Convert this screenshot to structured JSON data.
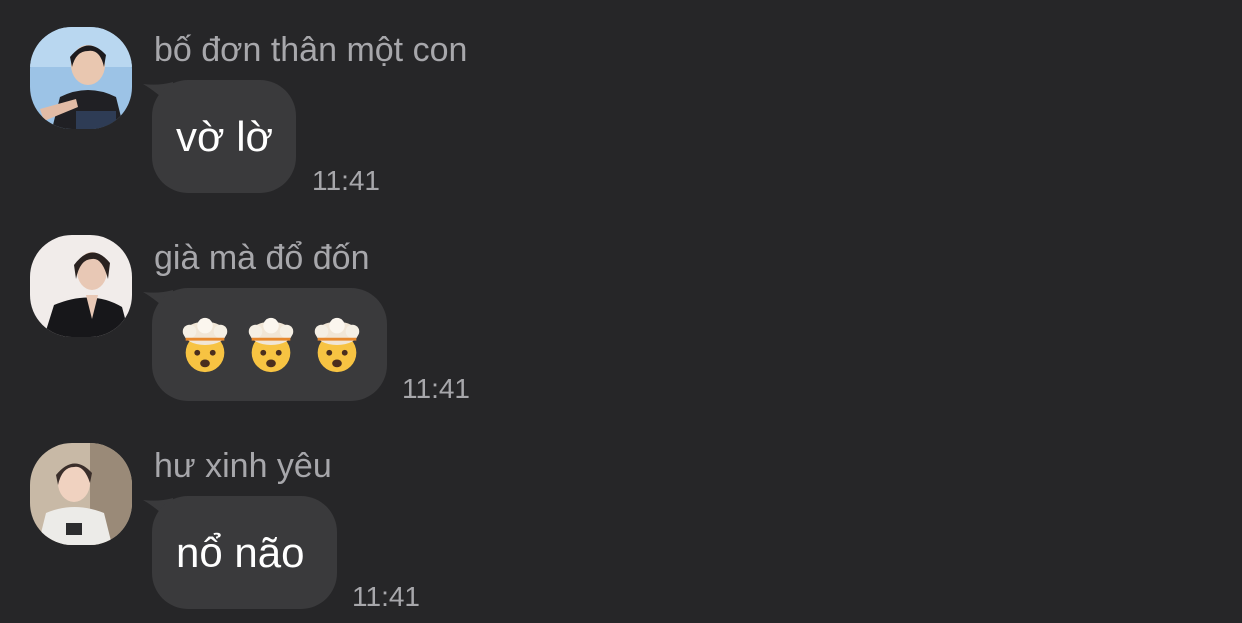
{
  "messages": [
    {
      "sender": "bố đơn thân một con",
      "text": "vờ lờ",
      "time": "11:41",
      "avatar_icon": "user-avatar-photo"
    },
    {
      "sender": "già mà đổ đốn",
      "text": "",
      "emoji": [
        "exploding-head-emoji",
        "exploding-head-emoji",
        "exploding-head-emoji"
      ],
      "time": "11:41",
      "avatar_icon": "user-avatar-photo"
    },
    {
      "sender": "hư xinh yêu",
      "text": "nổ não",
      "time": "11:41",
      "avatar_icon": "user-avatar-photo"
    }
  ],
  "colors": {
    "background": "#262628",
    "bubble": "#3a3a3c",
    "secondary_text": "#a7a7ab",
    "primary_text": "#ffffff"
  }
}
